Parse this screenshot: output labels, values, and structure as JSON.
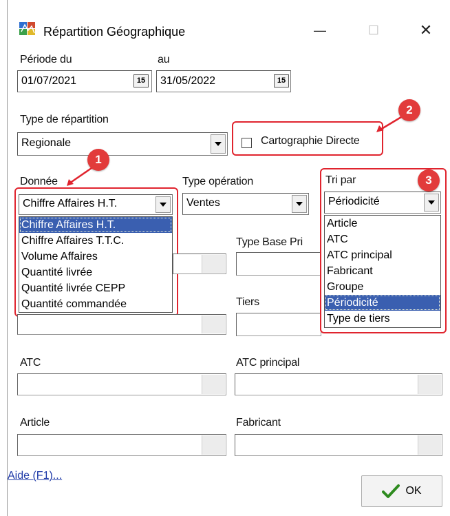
{
  "window": {
    "title": "Répartition Géographique",
    "minimize": "—",
    "maximize": "☐",
    "close": "✕"
  },
  "periode": {
    "label_du": "Période du",
    "label_au": "au",
    "date_du": "01/07/2021",
    "date_au": "31/05/2022",
    "calendar_icon_text": "15"
  },
  "type_repartition": {
    "label": "Type de répartition",
    "value": "Regionale"
  },
  "cartographie": {
    "label": "Cartographie Directe",
    "checked": false
  },
  "donnee": {
    "label": "Donnée",
    "value": "Chiffre Affaires H.T.",
    "options": [
      "Chiffre Affaires H.T.",
      "Chiffre Affaires T.T.C.",
      "Volume Affaires",
      "Quantité livrée",
      "Quantité livrée CEPP",
      "Quantité commandée"
    ],
    "selected_index": 0
  },
  "type_operation": {
    "label": "Type opération",
    "value": "Ventes"
  },
  "tri_par": {
    "label": "Tri par",
    "value": "Périodicité",
    "options": [
      "Article",
      "ATC",
      "ATC principal",
      "Fabricant",
      "Groupe",
      "Périodicité",
      "Type de tiers"
    ],
    "selected_index": 5
  },
  "fields": {
    "type_base_prix": "Type Base Pri",
    "tiers": "Tiers",
    "atc": "ATC",
    "atc_principal": "ATC principal",
    "article": "Article",
    "fabricant": "Fabricant"
  },
  "badges": {
    "one": "1",
    "two": "2",
    "three": "3"
  },
  "footer": {
    "help_link": "Aide (F1)...",
    "ok_label": "OK"
  },
  "colors": {
    "highlight": "#e0242e",
    "selection": "#3a5fb0",
    "link": "#1f3aa8",
    "ok_check": "#2e8b1f"
  }
}
